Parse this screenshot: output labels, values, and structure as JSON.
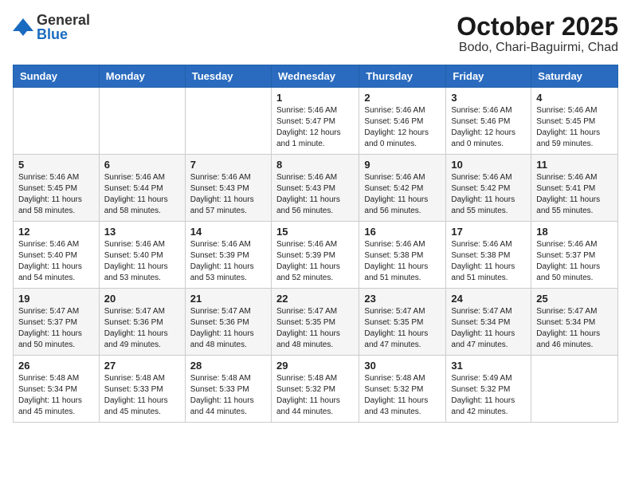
{
  "header": {
    "logo_general": "General",
    "logo_blue": "Blue",
    "month": "October 2025",
    "location": "Bodo, Chari-Baguirmi, Chad"
  },
  "days_of_week": [
    "Sunday",
    "Monday",
    "Tuesday",
    "Wednesday",
    "Thursday",
    "Friday",
    "Saturday"
  ],
  "weeks": [
    [
      {
        "day": "",
        "info": ""
      },
      {
        "day": "",
        "info": ""
      },
      {
        "day": "",
        "info": ""
      },
      {
        "day": "1",
        "info": "Sunrise: 5:46 AM\nSunset: 5:47 PM\nDaylight: 12 hours\nand 1 minute."
      },
      {
        "day": "2",
        "info": "Sunrise: 5:46 AM\nSunset: 5:46 PM\nDaylight: 12 hours\nand 0 minutes."
      },
      {
        "day": "3",
        "info": "Sunrise: 5:46 AM\nSunset: 5:46 PM\nDaylight: 12 hours\nand 0 minutes."
      },
      {
        "day": "4",
        "info": "Sunrise: 5:46 AM\nSunset: 5:45 PM\nDaylight: 11 hours\nand 59 minutes."
      }
    ],
    [
      {
        "day": "5",
        "info": "Sunrise: 5:46 AM\nSunset: 5:45 PM\nDaylight: 11 hours\nand 58 minutes."
      },
      {
        "day": "6",
        "info": "Sunrise: 5:46 AM\nSunset: 5:44 PM\nDaylight: 11 hours\nand 58 minutes."
      },
      {
        "day": "7",
        "info": "Sunrise: 5:46 AM\nSunset: 5:43 PM\nDaylight: 11 hours\nand 57 minutes."
      },
      {
        "day": "8",
        "info": "Sunrise: 5:46 AM\nSunset: 5:43 PM\nDaylight: 11 hours\nand 56 minutes."
      },
      {
        "day": "9",
        "info": "Sunrise: 5:46 AM\nSunset: 5:42 PM\nDaylight: 11 hours\nand 56 minutes."
      },
      {
        "day": "10",
        "info": "Sunrise: 5:46 AM\nSunset: 5:42 PM\nDaylight: 11 hours\nand 55 minutes."
      },
      {
        "day": "11",
        "info": "Sunrise: 5:46 AM\nSunset: 5:41 PM\nDaylight: 11 hours\nand 55 minutes."
      }
    ],
    [
      {
        "day": "12",
        "info": "Sunrise: 5:46 AM\nSunset: 5:40 PM\nDaylight: 11 hours\nand 54 minutes."
      },
      {
        "day": "13",
        "info": "Sunrise: 5:46 AM\nSunset: 5:40 PM\nDaylight: 11 hours\nand 53 minutes."
      },
      {
        "day": "14",
        "info": "Sunrise: 5:46 AM\nSunset: 5:39 PM\nDaylight: 11 hours\nand 53 minutes."
      },
      {
        "day": "15",
        "info": "Sunrise: 5:46 AM\nSunset: 5:39 PM\nDaylight: 11 hours\nand 52 minutes."
      },
      {
        "day": "16",
        "info": "Sunrise: 5:46 AM\nSunset: 5:38 PM\nDaylight: 11 hours\nand 51 minutes."
      },
      {
        "day": "17",
        "info": "Sunrise: 5:46 AM\nSunset: 5:38 PM\nDaylight: 11 hours\nand 51 minutes."
      },
      {
        "day": "18",
        "info": "Sunrise: 5:46 AM\nSunset: 5:37 PM\nDaylight: 11 hours\nand 50 minutes."
      }
    ],
    [
      {
        "day": "19",
        "info": "Sunrise: 5:47 AM\nSunset: 5:37 PM\nDaylight: 11 hours\nand 50 minutes."
      },
      {
        "day": "20",
        "info": "Sunrise: 5:47 AM\nSunset: 5:36 PM\nDaylight: 11 hours\nand 49 minutes."
      },
      {
        "day": "21",
        "info": "Sunrise: 5:47 AM\nSunset: 5:36 PM\nDaylight: 11 hours\nand 48 minutes."
      },
      {
        "day": "22",
        "info": "Sunrise: 5:47 AM\nSunset: 5:35 PM\nDaylight: 11 hours\nand 48 minutes."
      },
      {
        "day": "23",
        "info": "Sunrise: 5:47 AM\nSunset: 5:35 PM\nDaylight: 11 hours\nand 47 minutes."
      },
      {
        "day": "24",
        "info": "Sunrise: 5:47 AM\nSunset: 5:34 PM\nDaylight: 11 hours\nand 47 minutes."
      },
      {
        "day": "25",
        "info": "Sunrise: 5:47 AM\nSunset: 5:34 PM\nDaylight: 11 hours\nand 46 minutes."
      }
    ],
    [
      {
        "day": "26",
        "info": "Sunrise: 5:48 AM\nSunset: 5:34 PM\nDaylight: 11 hours\nand 45 minutes."
      },
      {
        "day": "27",
        "info": "Sunrise: 5:48 AM\nSunset: 5:33 PM\nDaylight: 11 hours\nand 45 minutes."
      },
      {
        "day": "28",
        "info": "Sunrise: 5:48 AM\nSunset: 5:33 PM\nDaylight: 11 hours\nand 44 minutes."
      },
      {
        "day": "29",
        "info": "Sunrise: 5:48 AM\nSunset: 5:32 PM\nDaylight: 11 hours\nand 44 minutes."
      },
      {
        "day": "30",
        "info": "Sunrise: 5:48 AM\nSunset: 5:32 PM\nDaylight: 11 hours\nand 43 minutes."
      },
      {
        "day": "31",
        "info": "Sunrise: 5:49 AM\nSunset: 5:32 PM\nDaylight: 11 hours\nand 42 minutes."
      },
      {
        "day": "",
        "info": ""
      }
    ]
  ]
}
